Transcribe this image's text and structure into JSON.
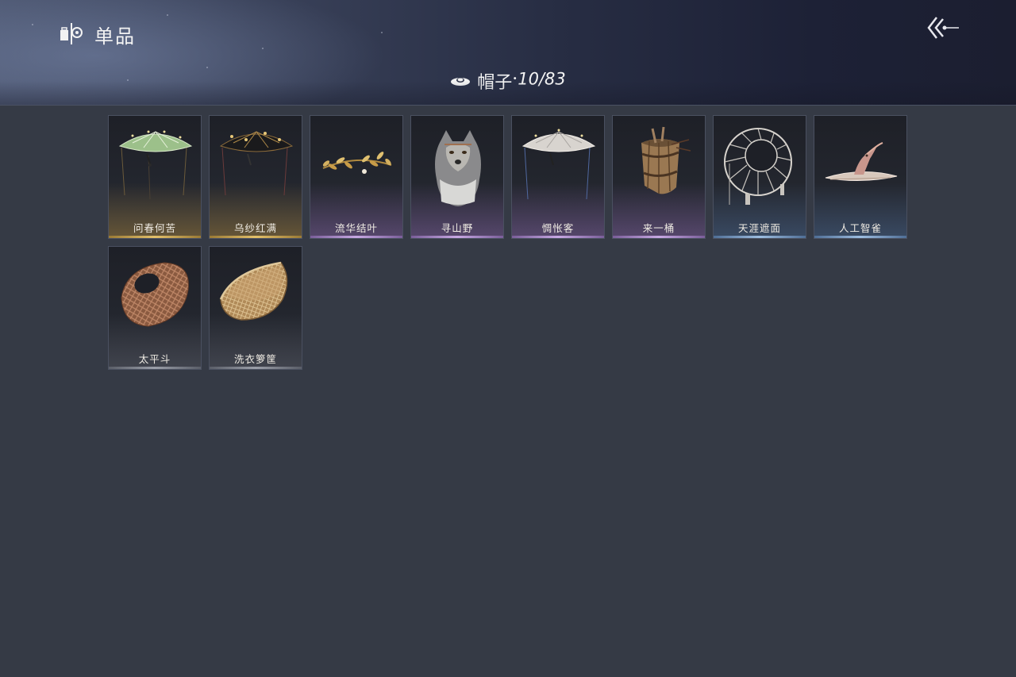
{
  "header": {
    "title": "单品",
    "logo_icon": "wardrobe-icon",
    "back_icon": "back-arrow-icon"
  },
  "category": {
    "icon": "hat-icon",
    "name": "帽子",
    "separator": "·",
    "count": "10/83"
  },
  "items": [
    {
      "name": "问春何苦",
      "icon": "green-veiled-bamboo-hat-icon",
      "rarity": "gold"
    },
    {
      "name": "乌纱红满",
      "icon": "black-veiled-hat-icon",
      "rarity": "gold"
    },
    {
      "name": "流华结叶",
      "icon": "golden-leaf-circlet-icon",
      "rarity": "purple"
    },
    {
      "name": "寻山野",
      "icon": "wolf-head-hood-icon",
      "rarity": "purple"
    },
    {
      "name": "惆怅客",
      "icon": "white-veiled-hat-icon",
      "rarity": "purple"
    },
    {
      "name": "来一桶",
      "icon": "wooden-bucket-hat-icon",
      "rarity": "purple"
    },
    {
      "name": "天涯遮面",
      "icon": "woven-ring-veil-hat-icon",
      "rarity": "blue"
    },
    {
      "name": "人工智雀",
      "icon": "bird-flat-hat-icon",
      "rarity": "blue"
    },
    {
      "name": "太平斗",
      "icon": "woven-wicker-basket-hat-icon",
      "rarity": "gray"
    },
    {
      "name": "洗衣箩筐",
      "icon": "wicker-laundry-basket-icon",
      "rarity": "gray"
    }
  ],
  "colors": {
    "background": "#353a45",
    "rarity_gold": "#e3c06a",
    "rarity_purple": "#c7a8e3",
    "rarity_blue": "#9dbde0",
    "rarity_gray": "#9a9ea8"
  }
}
